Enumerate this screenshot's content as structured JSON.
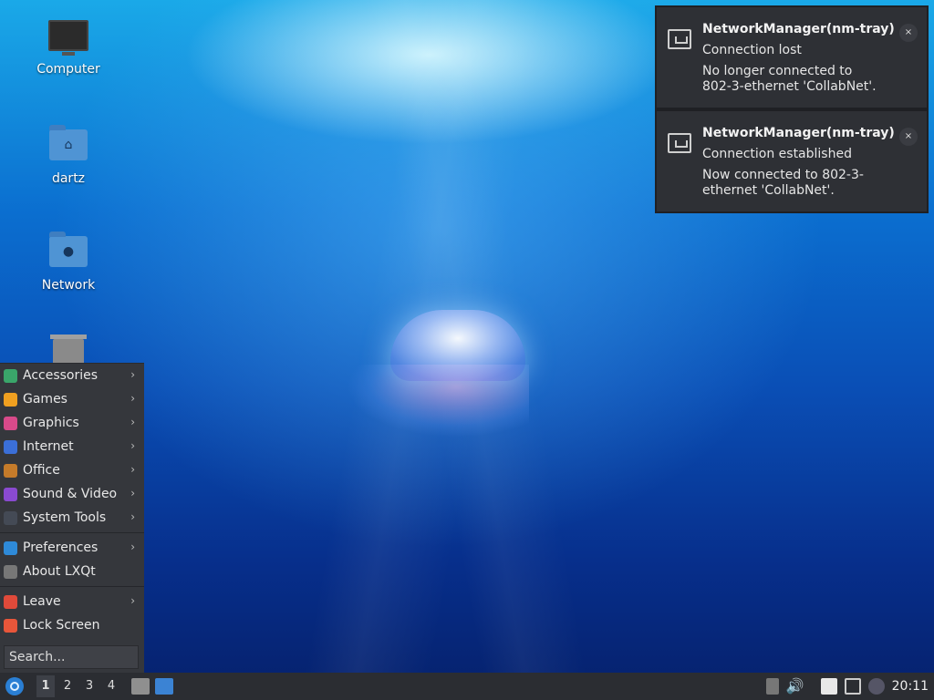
{
  "desktop": {
    "icons": [
      {
        "label": "Computer",
        "icon": "computer-icon"
      },
      {
        "label": "dartz",
        "icon": "home-folder-icon"
      },
      {
        "label": "Network",
        "icon": "network-folder-icon"
      },
      {
        "label": "",
        "icon": "trash-icon"
      }
    ]
  },
  "notifications": [
    {
      "app": "NetworkManager(nm-tray)",
      "summary": "Connection lost",
      "body": "No longer connected to 802-3-ethernet 'CollabNet'.",
      "close": "×"
    },
    {
      "app": "NetworkManager(nm-tray)",
      "summary": "Connection established",
      "body": "Now connected to 802-3-ethernet 'CollabNet'.",
      "close": "×"
    }
  ],
  "menu": {
    "items": [
      {
        "label": "Accessories",
        "submenu": true,
        "color": "#3aa66a"
      },
      {
        "label": "Games",
        "submenu": true,
        "color": "#f0a020"
      },
      {
        "label": "Graphics",
        "submenu": true,
        "color": "#d84a8a"
      },
      {
        "label": "Internet",
        "submenu": true,
        "color": "#3b6fd8"
      },
      {
        "label": "Office",
        "submenu": true,
        "color": "#c57b2a"
      },
      {
        "label": "Sound & Video",
        "submenu": true,
        "color": "#8a4ad0"
      },
      {
        "label": "System Tools",
        "submenu": true,
        "color": "#444a55"
      }
    ],
    "prefs": [
      {
        "label": "Preferences",
        "submenu": true,
        "color": "#2e8ad8"
      },
      {
        "label": "About LXQt",
        "submenu": false,
        "color": "#777777"
      }
    ],
    "session": [
      {
        "label": "Leave",
        "submenu": true,
        "color": "#e04a3a"
      },
      {
        "label": "Lock Screen",
        "submenu": false,
        "color": "#e8563a"
      }
    ],
    "search_placeholder": "Search...",
    "arrow": "›"
  },
  "taskbar": {
    "workspaces": [
      "1",
      "2",
      "3",
      "4"
    ],
    "active_workspace": "1",
    "clock": "20:11"
  }
}
